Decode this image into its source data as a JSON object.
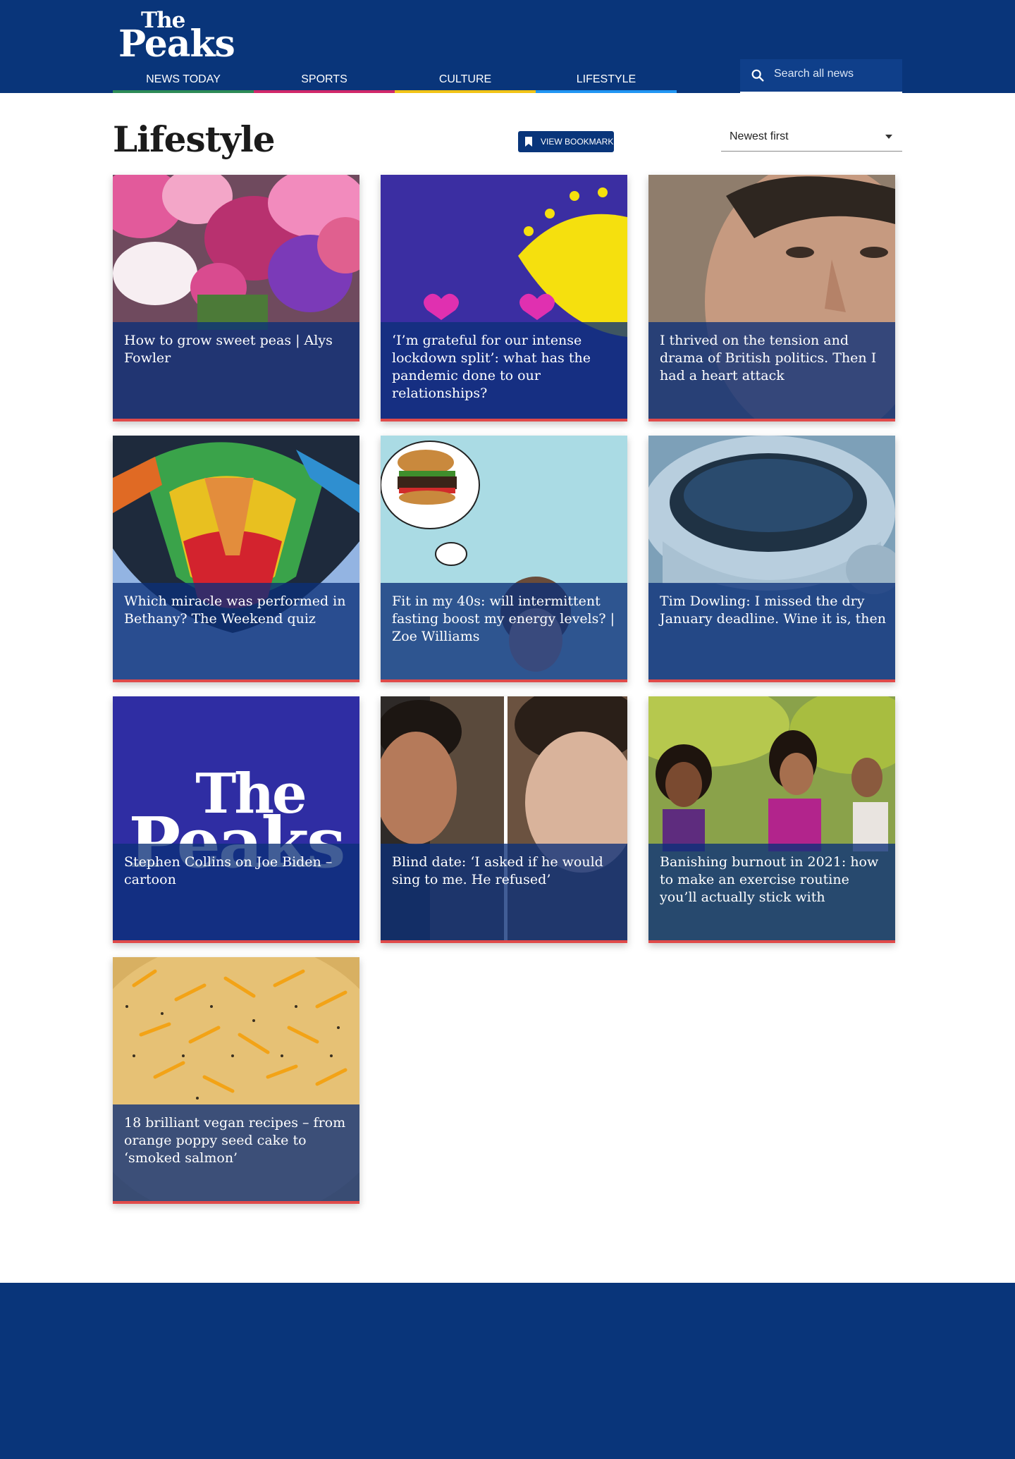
{
  "brand": {
    "line1": "The",
    "line2": "Peaks"
  },
  "nav": [
    {
      "label": "NEWS TODAY",
      "color": "#2e8b57"
    },
    {
      "label": "SPORTS",
      "color": "#d1286a"
    },
    {
      "label": "CULTURE",
      "color": "#f2c417"
    },
    {
      "label": "LIFESTYLE",
      "color": "#2196f3"
    }
  ],
  "search": {
    "placeholder": "Search all news"
  },
  "page": {
    "title": "Lifestyle"
  },
  "bookmark": {
    "label": "VIEW BOOKMARK"
  },
  "sort": {
    "value": "Newest first"
  },
  "articles": [
    {
      "title": "How to grow sweet peas | Alys Fowler"
    },
    {
      "title": "‘I’m grateful for our intense lockdown split’: what has the pandemic done to our relationships?"
    },
    {
      "title": "I thrived on the tension and drama of British politics. Then I had a heart attack"
    },
    {
      "title": "Which miracle was performed in Bethany? The Weekend quiz"
    },
    {
      "title": "Fit in my 40s: will intermittent fasting boost my energy levels? | Zoe Williams"
    },
    {
      "title": "Tim Dowling: I missed the dry January deadline. Wine it is, then"
    },
    {
      "title": "Stephen Collins on Joe Biden – cartoon",
      "image_text": {
        "line1": "The",
        "line2": "Peaks"
      }
    },
    {
      "title": "Blind date: ‘I asked if he would sing to me. He refused’"
    },
    {
      "title": "Banishing burnout in 2021: how to make an exercise routine you’ll actually stick with"
    },
    {
      "title": "18 brilliant vegan recipes – from orange poppy seed cake to ‘smoked salmon’"
    }
  ]
}
